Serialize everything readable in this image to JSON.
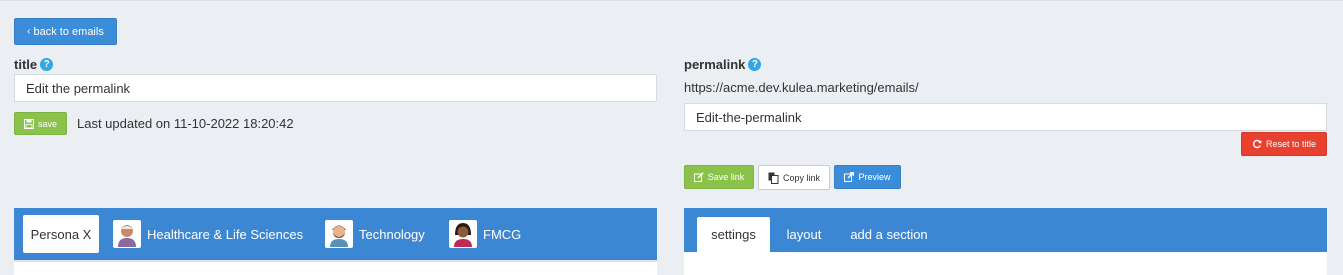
{
  "back_button": {
    "label": "back to emails"
  },
  "title_section": {
    "label": "title",
    "help": "?",
    "value": "Edit the permalink",
    "save_label": "save",
    "last_updated": "Last updated on 11-10-2022 18:20:42"
  },
  "permalink_section": {
    "label": "permalink",
    "help": "?",
    "base_url": "https://acme.dev.kulea.marketing/emails/",
    "value": "Edit-the-permalink",
    "reset_label": "Reset to title",
    "save_link_label": "Save link",
    "copy_link_label": "Copy link",
    "preview_label": "Preview"
  },
  "persona_tabs": [
    {
      "label": "Persona X",
      "icon": "none"
    },
    {
      "label": "Healthcare & Life Sciences",
      "icon": "avatar-older-man"
    },
    {
      "label": "Technology",
      "icon": "avatar-bearded-man"
    },
    {
      "label": "FMCG",
      "icon": "avatar-woman"
    }
  ],
  "editor_tabs": [
    {
      "label": "settings"
    },
    {
      "label": "layout"
    },
    {
      "label": "add a section"
    }
  ],
  "colors": {
    "primary_blue": "#3c87d3",
    "button_blue": "#3c8dd9",
    "save_green": "#8bc34a",
    "reset_red": "#e8412f",
    "help_blue": "#2fa8e3",
    "background": "#ebeef3"
  }
}
